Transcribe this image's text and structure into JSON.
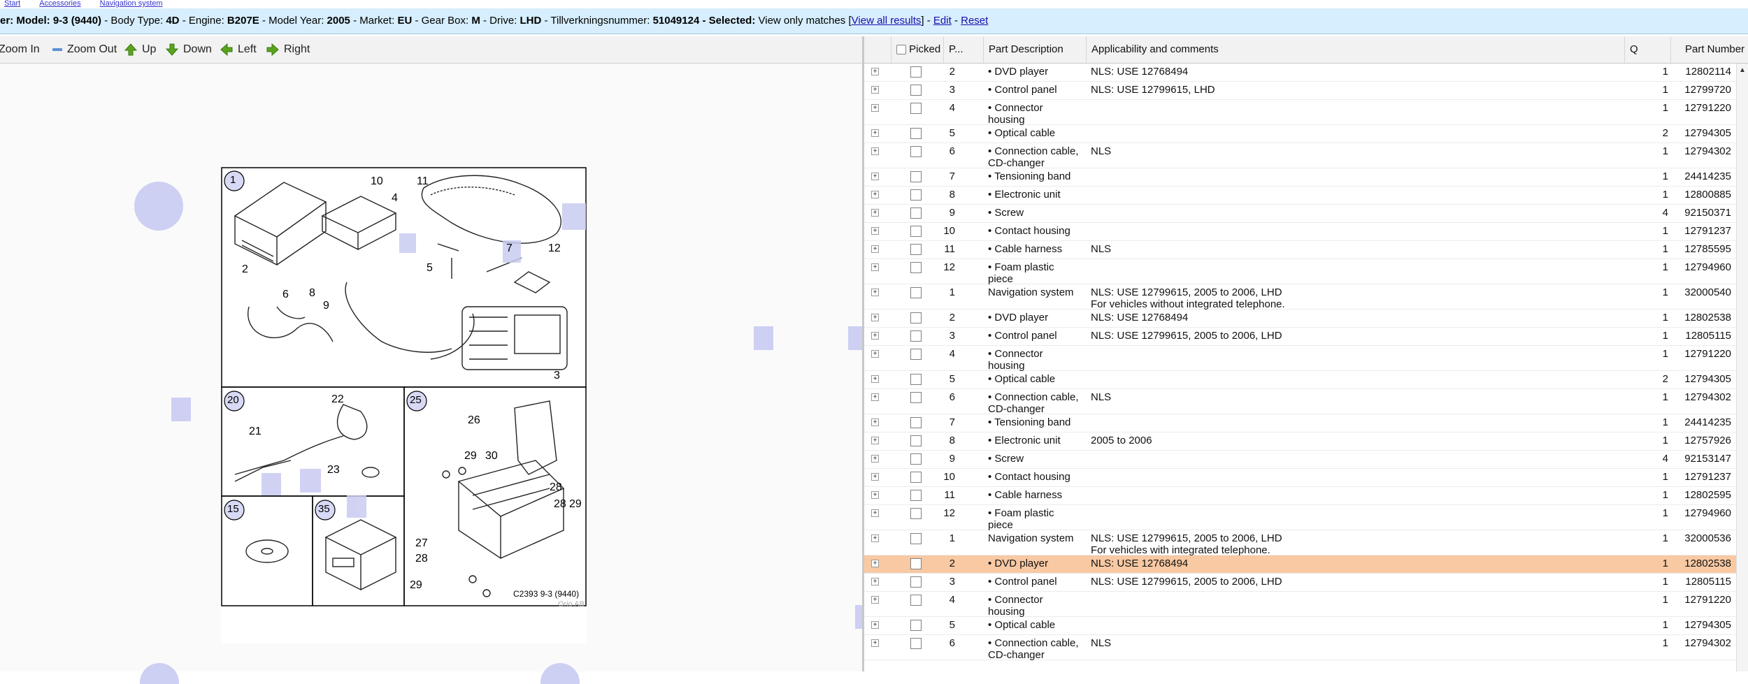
{
  "top_links": [
    "Start",
    "Accessories",
    "Navigation system"
  ],
  "info_bar": {
    "model_label": "er: Model:",
    "model": "9-3 (9440)",
    "body_label": "- Body Type:",
    "body": "4D",
    "engine_label": "- Engine:",
    "engine": "B207E",
    "year_label": "- Model Year:",
    "year": "2005",
    "market_label": "- Market:",
    "market": "EU",
    "gearbox_label": "- Gear Box:",
    "gearbox": "M",
    "drive_label": "- Drive:",
    "drive": "LHD",
    "tvn_label": "- Tillverkningsnummer:",
    "tvn": "51049124",
    "selected_label": "- Selected:",
    "selected_text": "View only matches",
    "view_all": "View all results",
    "edit": "Edit",
    "reset": "Reset"
  },
  "toolbar": {
    "zoom_in": "Zoom In",
    "zoom_out": "Zoom Out",
    "up": "Up",
    "down": "Down",
    "left": "Left",
    "right": "Right"
  },
  "diagram": {
    "caption": "C2393 9-3 (9440)",
    "copyright": "Orio AB",
    "panel_numbers": [
      "1",
      "20",
      "25",
      "15",
      "35"
    ],
    "callouts": [
      "10",
      "4",
      "11",
      "2",
      "8",
      "9",
      "6",
      "7",
      "12",
      "5",
      "3",
      "22",
      "21",
      "23",
      "26",
      "29",
      "30",
      "28",
      "28",
      "29",
      "27",
      "28",
      "29"
    ]
  },
  "table": {
    "headers": {
      "picked": "Picked",
      "pos": "P...",
      "desc": "Part Description",
      "app": "Applicability and comments",
      "q": "Q",
      "pn": "Part Number"
    },
    "rows": [
      {
        "pos": "2",
        "desc": "• DVD player",
        "app": "NLS: USE 12768494",
        "q": "1",
        "pn": "12802114"
      },
      {
        "pos": "3",
        "desc": "• Control panel",
        "app": "NLS: USE 12799615, LHD",
        "q": "1",
        "pn": "12799720"
      },
      {
        "pos": "4",
        "desc": "• Connector\nhousing",
        "app": "",
        "q": "1",
        "pn": "12791220"
      },
      {
        "pos": "5",
        "desc": "• Optical cable",
        "app": "",
        "q": "2",
        "pn": "12794305"
      },
      {
        "pos": "6",
        "desc": "• Connection cable,\nCD-changer",
        "app": "NLS",
        "q": "1",
        "pn": "12794302"
      },
      {
        "pos": "7",
        "desc": "• Tensioning band",
        "app": "",
        "q": "1",
        "pn": "24414235"
      },
      {
        "pos": "8",
        "desc": "• Electronic unit",
        "app": "",
        "q": "1",
        "pn": "12800885"
      },
      {
        "pos": "9",
        "desc": "• Screw",
        "app": "",
        "q": "4",
        "pn": "92150371"
      },
      {
        "pos": "10",
        "desc": "• Contact housing",
        "app": "",
        "q": "1",
        "pn": "12791237"
      },
      {
        "pos": "11",
        "desc": "• Cable harness",
        "app": "NLS",
        "q": "1",
        "pn": "12785595"
      },
      {
        "pos": "12",
        "desc": "• Foam plastic\npiece",
        "app": "",
        "q": "1",
        "pn": "12794960"
      },
      {
        "pos": "1",
        "desc": "Navigation system",
        "app": "NLS: USE 12799615, 2005 to 2006, LHD\nFor vehicles without integrated telephone.",
        "q": "1",
        "pn": "32000540"
      },
      {
        "pos": "2",
        "desc": "• DVD player",
        "app": "NLS: USE 12768494",
        "q": "1",
        "pn": "12802538"
      },
      {
        "pos": "3",
        "desc": "• Control panel",
        "app": "NLS: USE 12799615, 2005 to 2006, LHD",
        "q": "1",
        "pn": "12805115"
      },
      {
        "pos": "4",
        "desc": "• Connector\nhousing",
        "app": "",
        "q": "1",
        "pn": "12791220"
      },
      {
        "pos": "5",
        "desc": "• Optical cable",
        "app": "",
        "q": "2",
        "pn": "12794305"
      },
      {
        "pos": "6",
        "desc": "• Connection cable,\nCD-changer",
        "app": "NLS",
        "q": "1",
        "pn": "12794302"
      },
      {
        "pos": "7",
        "desc": "• Tensioning band",
        "app": "",
        "q": "1",
        "pn": "24414235"
      },
      {
        "pos": "8",
        "desc": "• Electronic unit",
        "app": "2005 to 2006",
        "q": "1",
        "pn": "12757926"
      },
      {
        "pos": "9",
        "desc": "• Screw",
        "app": "",
        "q": "4",
        "pn": "92153147"
      },
      {
        "pos": "10",
        "desc": "• Contact housing",
        "app": "",
        "q": "1",
        "pn": "12791237"
      },
      {
        "pos": "11",
        "desc": "• Cable harness",
        "app": "",
        "q": "1",
        "pn": "12802595"
      },
      {
        "pos": "12",
        "desc": "• Foam plastic\npiece",
        "app": "",
        "q": "1",
        "pn": "12794960"
      },
      {
        "pos": "1",
        "desc": "Navigation system",
        "app": "NLS: USE 12799615, 2005 to 2006, LHD\nFor vehicles with integrated telephone.",
        "q": "1",
        "pn": "32000536"
      },
      {
        "pos": "2",
        "desc": "• DVD player",
        "app": "NLS: USE 12768494",
        "q": "1",
        "pn": "12802538",
        "highlight": true
      },
      {
        "pos": "3",
        "desc": "• Control panel",
        "app": "NLS: USE 12799615, 2005 to 2006, LHD",
        "q": "1",
        "pn": "12805115"
      },
      {
        "pos": "4",
        "desc": "• Connector\nhousing",
        "app": "",
        "q": "1",
        "pn": "12791220"
      },
      {
        "pos": "5",
        "desc": "• Optical cable",
        "app": "",
        "q": "1",
        "pn": "12794305"
      },
      {
        "pos": "6",
        "desc": "• Connection cable,\nCD-changer",
        "app": "NLS",
        "q": "1",
        "pn": "12794302"
      }
    ]
  },
  "colors": {
    "info_bar_bg": "#d6eefd",
    "highlight_row": "#f8c9a3",
    "arrow_green": "#5aa321",
    "marker": "#cdd0f2"
  }
}
